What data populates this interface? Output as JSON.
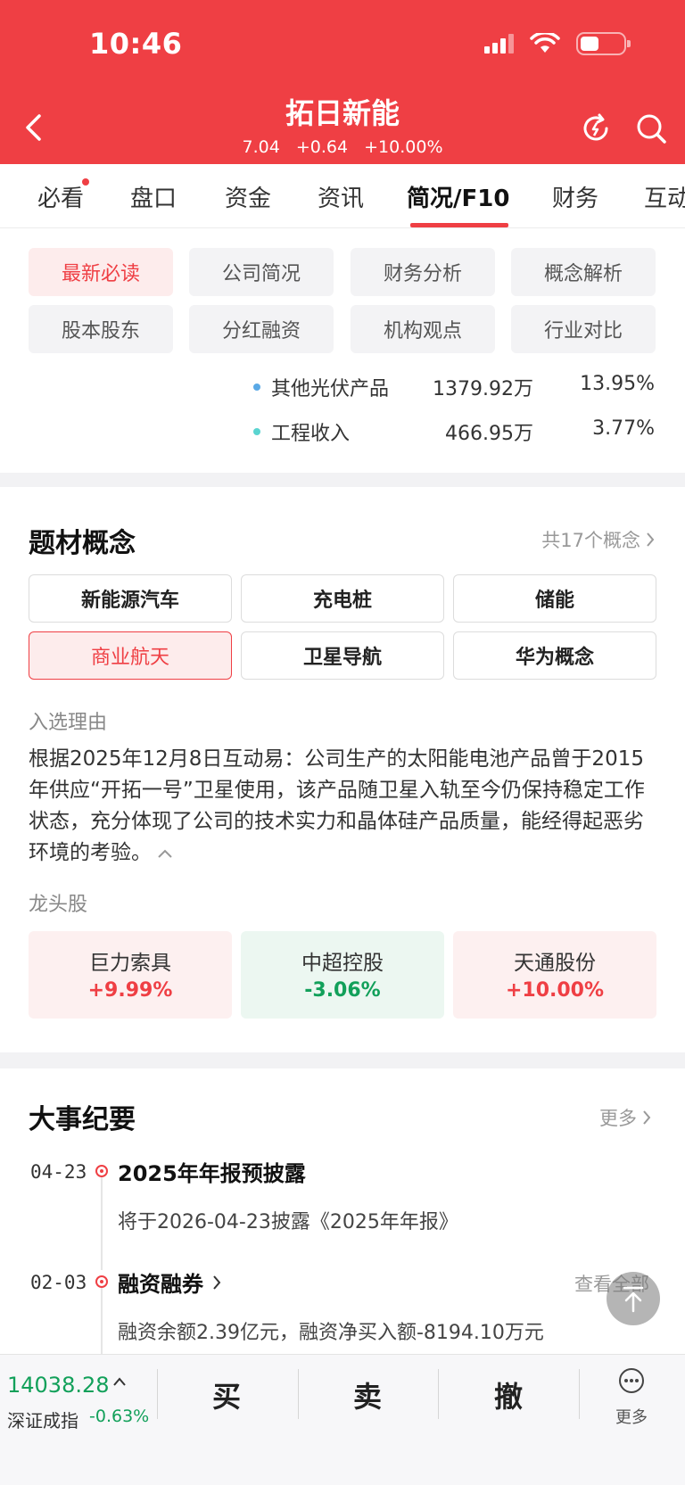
{
  "status_bar": {
    "time": "10:46"
  },
  "header": {
    "title": "拓日新能",
    "price": "7.04",
    "change": "+0.64",
    "change_pct": "+10.00%",
    "accent_color": "#ef3f44"
  },
  "tabs": [
    {
      "label": "必看"
    },
    {
      "label": "盘口"
    },
    {
      "label": "资金"
    },
    {
      "label": "资讯"
    },
    {
      "label": "简况/F10"
    },
    {
      "label": "财务"
    },
    {
      "label": "互动"
    }
  ],
  "active_tab": "简况/F10",
  "sub_tabs": [
    {
      "label": "最新必读"
    },
    {
      "label": "公司简况"
    },
    {
      "label": "财务分析"
    },
    {
      "label": "概念解析"
    },
    {
      "label": "股本股东"
    },
    {
      "label": "分红融资"
    },
    {
      "label": "机构观点"
    },
    {
      "label": "行业对比"
    }
  ],
  "revenue_rows": [
    {
      "name": "其他光伏产品",
      "amount": "1379.92万",
      "pct": "13.95%",
      "dot_color": "#5aa9e6"
    },
    {
      "name": "工程收入",
      "amount": "466.95万",
      "pct": "3.77%",
      "dot_color": "#5ad4d0"
    }
  ],
  "concepts": {
    "title": "题材概念",
    "count_label": "共17个概念",
    "items": [
      {
        "label": "新能源汽车"
      },
      {
        "label": "充电桩"
      },
      {
        "label": "储能"
      },
      {
        "label": "商业航天"
      },
      {
        "label": "卫星导航"
      },
      {
        "label": "华为概念"
      }
    ],
    "reason_label": "入选理由",
    "reason_text": "根据2025年12月8日互动易：公司生产的太阳能电池产品曾于2015年供应“开拓一号”卫星使用，该产品随卫星入轨至今仍保持稳定工作状态，充分体现了公司的技术实力和晶体硅产品质量，能经得起恶劣环境的考验。",
    "leader_label": "龙头股",
    "leaders": [
      {
        "name": "巨力索具",
        "change": "+9.99%"
      },
      {
        "name": "中超控股",
        "change": "-3.06%"
      },
      {
        "name": "天通股份",
        "change": "+10.00%"
      }
    ]
  },
  "events": {
    "title": "大事纪要",
    "more_label": "更多",
    "items": [
      {
        "date": "04-23",
        "title": "2025年年报预披露",
        "desc": "将于2026-04-23披露《2025年年报》"
      },
      {
        "date": "02-03",
        "title": "融资融券",
        "desc": "融资余额2.39亿元，融资净买入额-8194.10万元",
        "more": "查看全部"
      }
    ]
  },
  "bottom_bar": {
    "index_value": "14038.28",
    "index_name": "深证成指",
    "index_change": "-0.63%",
    "buy": "买",
    "sell": "卖",
    "cancel": "撤",
    "more": "更多"
  }
}
